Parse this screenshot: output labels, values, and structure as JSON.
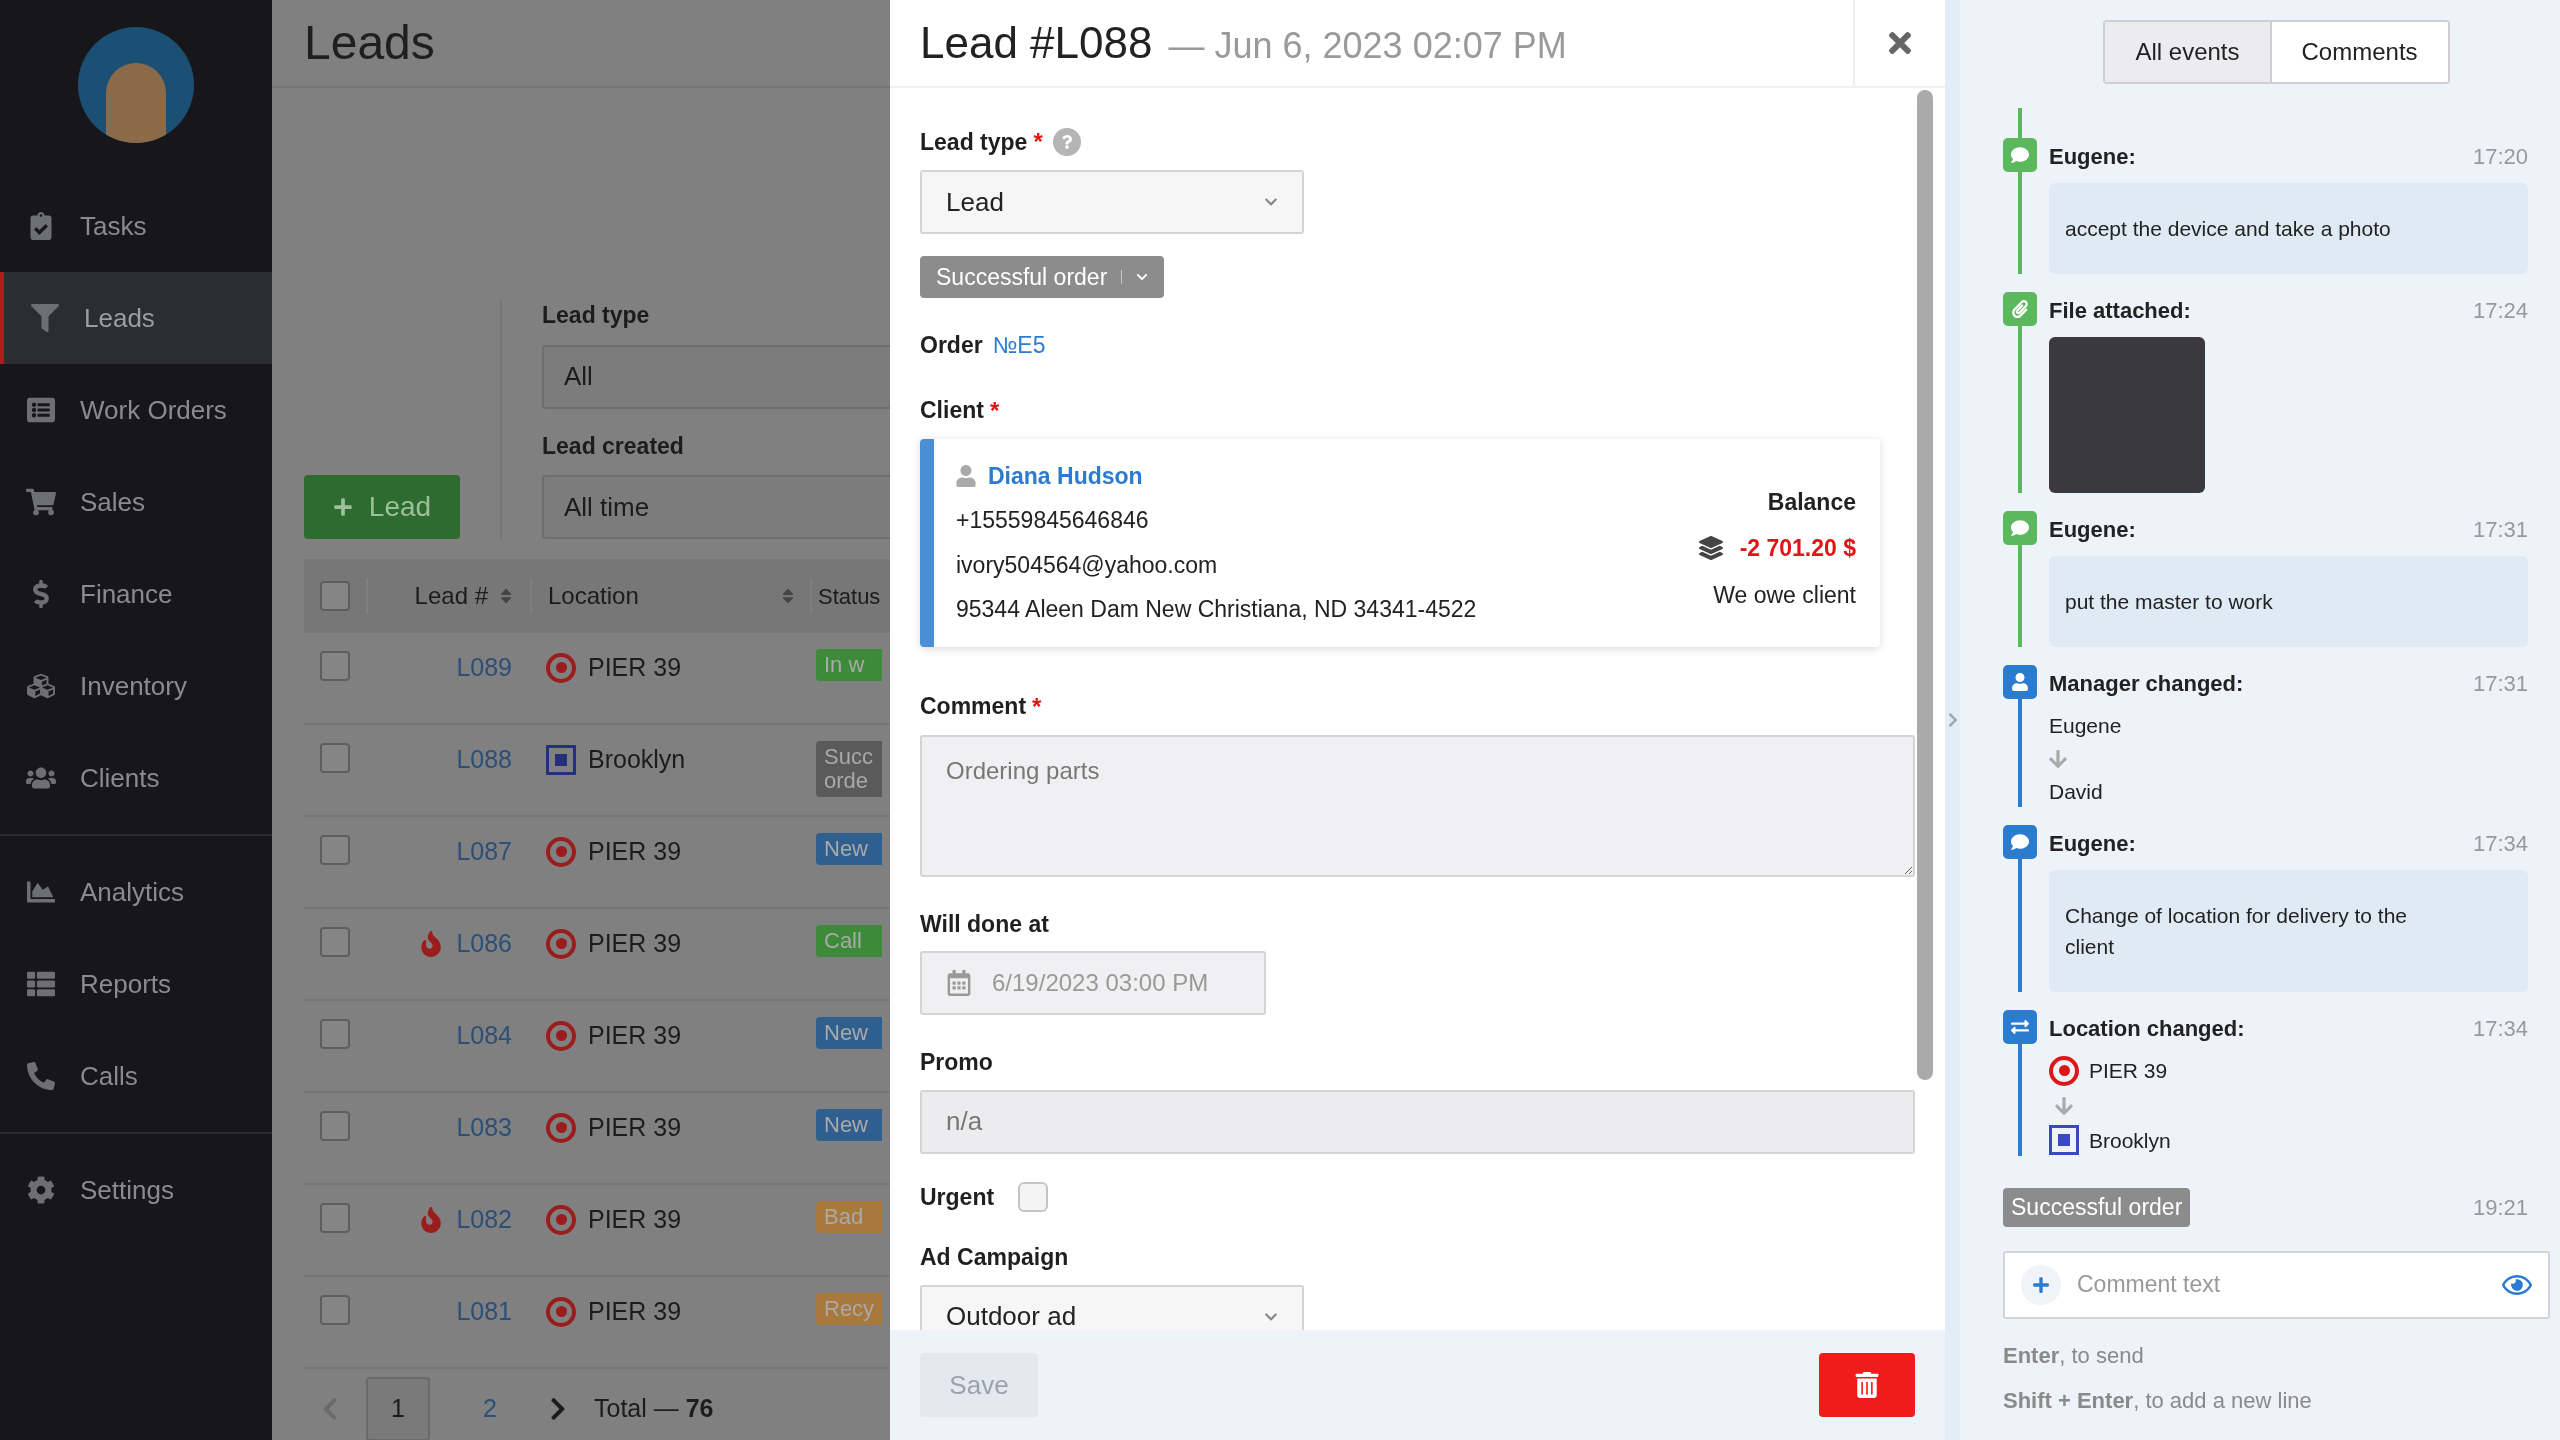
{
  "sidebar": {
    "groups": [
      [
        {
          "label": "Tasks",
          "selected": false
        },
        {
          "label": "Leads",
          "selected": true
        },
        {
          "label": "Work Orders",
          "selected": false
        },
        {
          "label": "Sales",
          "selected": false
        },
        {
          "label": "Finance",
          "selected": false
        },
        {
          "label": "Inventory",
          "selected": false
        },
        {
          "label": "Clients",
          "selected": false
        }
      ],
      [
        {
          "label": "Analytics",
          "selected": false
        },
        {
          "label": "Reports",
          "selected": false
        },
        {
          "label": "Calls",
          "selected": false
        }
      ],
      [
        {
          "label": "Settings",
          "selected": false
        }
      ]
    ]
  },
  "leads_page": {
    "title": "Leads",
    "add_button": "Lead",
    "filters": [
      {
        "label": "Lead type",
        "value": "All"
      },
      {
        "label": "Lead created",
        "value": "All time"
      }
    ],
    "table": {
      "select_all": {
        "checked": false
      },
      "columns": [
        "Lead #",
        "Location",
        "Status"
      ],
      "rows": [
        {
          "checked": false,
          "hot": false,
          "id": "L089",
          "location": {
            "label": "PIER 39",
            "kind": "target"
          },
          "status": "In w",
          "color": "#3d8a3b"
        },
        {
          "checked": false,
          "hot": false,
          "id": "L088",
          "location": {
            "label": "Brooklyn",
            "kind": "square"
          },
          "status": "Succ orde",
          "color": "#5a5a5a"
        },
        {
          "checked": false,
          "hot": false,
          "id": "L087",
          "location": {
            "label": "PIER 39",
            "kind": "target"
          },
          "status": "New",
          "color": "#2e5f8f"
        },
        {
          "checked": false,
          "hot": true,
          "id": "L086",
          "location": {
            "label": "PIER 39",
            "kind": "target"
          },
          "status": "Call",
          "color": "#3d8a3b"
        },
        {
          "checked": false,
          "hot": false,
          "id": "L084",
          "location": {
            "label": "PIER 39",
            "kind": "target"
          },
          "status": "New",
          "color": "#2e5f8f"
        },
        {
          "checked": false,
          "hot": false,
          "id": "L083",
          "location": {
            "label": "PIER 39",
            "kind": "target"
          },
          "status": "New",
          "color": "#2e5f8f"
        },
        {
          "checked": false,
          "hot": true,
          "id": "L082",
          "location": {
            "label": "PIER 39",
            "kind": "target"
          },
          "status": "Bad",
          "color": "#a8783c"
        },
        {
          "checked": false,
          "hot": false,
          "id": "L081",
          "location": {
            "label": "PIER 39",
            "kind": "target"
          },
          "status": "Recy",
          "color": "#a8783c"
        }
      ]
    },
    "pagination": {
      "pages": [
        {
          "label": "1",
          "selected": true
        },
        {
          "label": "2",
          "selected": false
        }
      ],
      "total": "Total — **76**"
    }
  },
  "lead_dialog": {
    "title": "Lead #L088",
    "date": "— Jun 6, 2023 02:07 PM",
    "lead_type": {
      "label": "Lead type",
      "required_mark": "*",
      "value": "Lead"
    },
    "status": "Successful order",
    "order": {
      "label": "Order",
      "link": "№E5"
    },
    "client": {
      "label": "Client",
      "required_mark": "*",
      "name": "Diana Hudson",
      "phone": "+15559845646846",
      "email": "ivory504564@yahoo.com",
      "address": "95344 Aleen Dam New Christiana, ND 34341-4522",
      "balance_label": "Balance",
      "balance": "-2 701.20 $",
      "balance_note": "We owe client"
    },
    "comment": {
      "label": "Comment",
      "required_mark": "*",
      "value": "Ordering parts"
    },
    "will_done_at": {
      "label": "Will done at",
      "value": "6/19/2023 03:00 PM"
    },
    "promo": {
      "label": "Promo",
      "value": "n/a"
    },
    "urgent": {
      "label": "Urgent",
      "checked": false
    },
    "ad_campaign": {
      "label": "Ad Campaign",
      "value": "Outdoor ad"
    },
    "save_button": {
      "label": "Save",
      "disabled": true
    }
  },
  "history": {
    "tabs": [
      {
        "label": "All events",
        "selected": true
      },
      {
        "label": "Comments",
        "selected": false
      }
    ],
    "events": [
      {
        "kind": "comment",
        "color": "#5cb85c",
        "title": "Eugene:",
        "time": "17:20",
        "text": "accept the device and take a photo"
      },
      {
        "kind": "file",
        "color": "#5cb85c",
        "title": "File attached:",
        "time": "17:24"
      },
      {
        "kind": "comment",
        "color": "#5cb85c",
        "title": "Eugene:",
        "time": "17:31",
        "text": "put the master to work"
      },
      {
        "kind": "manager",
        "color": "#2b7bd0",
        "title": "Manager changed:",
        "time": "17:31",
        "from": "Eugene",
        "to": "David"
      },
      {
        "kind": "comment",
        "color": "#2b7bd0",
        "title": "Eugene:",
        "time": "17:34",
        "text": "Change of location for delivery to the client"
      },
      {
        "kind": "location",
        "color": "#2b7bd0",
        "title": "Location changed:",
        "time": "17:34",
        "from": {
          "label": "PIER 39",
          "kind": "target"
        },
        "to": {
          "label": "Brooklyn",
          "kind": "square"
        }
      },
      {
        "kind": "status",
        "color": "#8c8c8c",
        "title": "Successful order",
        "time": "19:21"
      }
    ],
    "comment_field": {
      "placeholder": "Comment text"
    },
    "hints": [
      "**Enter**, to send",
      "**Shift + Enter**, to add a new line"
    ]
  }
}
